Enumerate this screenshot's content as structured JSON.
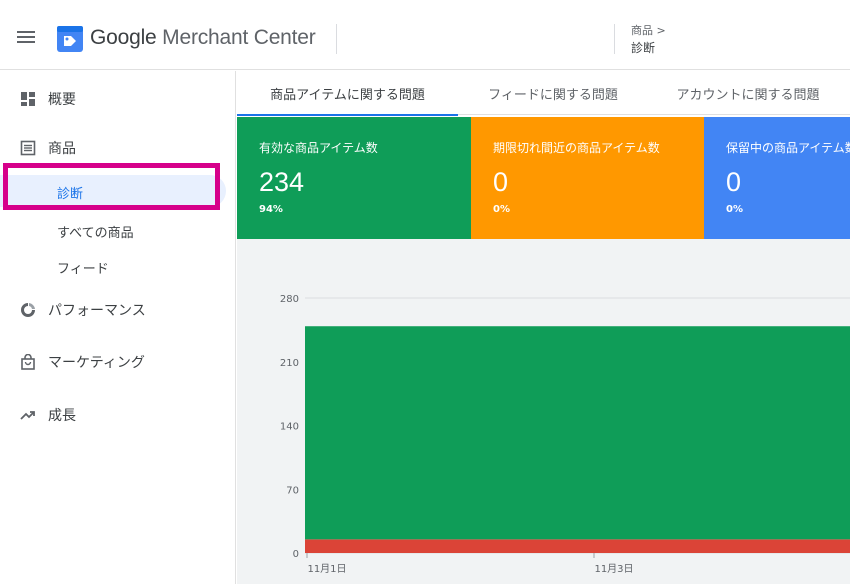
{
  "header": {
    "app_title_google": "Google",
    "app_title_rest": " Merchant Center",
    "breadcrumb_parent": "商品 >",
    "breadcrumb_current": "診断"
  },
  "sidebar": {
    "items": [
      {
        "label": "概要",
        "icon": "dashboard-icon"
      },
      {
        "label": "商品",
        "icon": "list-icon"
      },
      {
        "label": "パフォーマンス",
        "icon": "donut-chart-icon"
      },
      {
        "label": "マーケティング",
        "icon": "shopping-bag-icon"
      },
      {
        "label": "成長",
        "icon": "trending-up-icon"
      }
    ],
    "sub_items": [
      {
        "label": "診断",
        "active": true
      },
      {
        "label": "すべての商品"
      },
      {
        "label": "フィード"
      }
    ]
  },
  "tabs": [
    {
      "label": "商品アイテムに関する問題",
      "active": true
    },
    {
      "label": "フィードに関する問題"
    },
    {
      "label": "アカウントに関する問題"
    }
  ],
  "cards": [
    {
      "title": "有効な商品アイテム数",
      "value": "234",
      "percent": "94%",
      "color": "#0f9d58"
    },
    {
      "title": "期限切れ間近の商品アイテム数",
      "value": "0",
      "percent": "0%",
      "color": "#ff9800"
    },
    {
      "title": "保留中の商品アイテム数",
      "value": "0",
      "percent": "0%",
      "color": "#4285f4"
    }
  ],
  "colors": {
    "accent": "#1a73e8",
    "annotation_box": "#d6008a",
    "active_series": "#0f9d58",
    "disapproved_series": "#db4437"
  },
  "chart_data": {
    "type": "area",
    "stacked": true,
    "x": [
      "11月1日",
      "11月3日"
    ],
    "yticks": [
      0,
      70,
      140,
      210,
      280
    ],
    "ylim": [
      0,
      280
    ],
    "series": [
      {
        "values": [
          15,
          15
        ],
        "color": "#db4437"
      },
      {
        "values": [
          234,
          234
        ],
        "color": "#0f9d58"
      }
    ]
  }
}
